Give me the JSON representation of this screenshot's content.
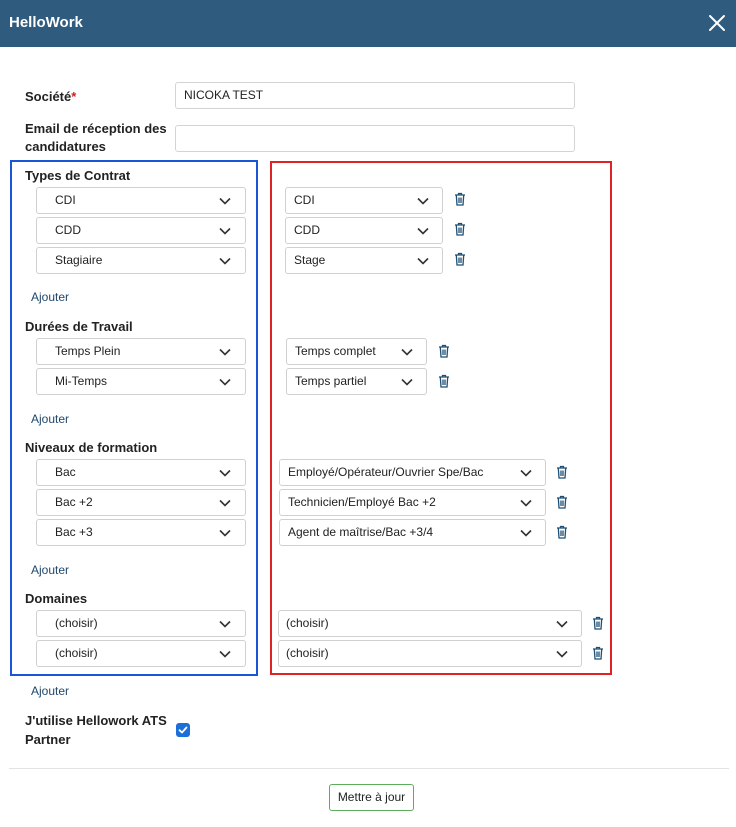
{
  "dialog": {
    "title": "HelloWork",
    "close_icon": "close-icon"
  },
  "form": {
    "societe_label": "Société",
    "required_mark": "*",
    "societe_value": "NICOKA TEST",
    "email_label_line1": "Email de réception des",
    "email_label_line2": "candidatures",
    "email_value": ""
  },
  "sections": {
    "contrat": {
      "title": "Types de Contrat",
      "left": [
        "CDI",
        "CDD",
        "Stagiaire"
      ],
      "right": [
        "CDI",
        "CDD",
        "Stage"
      ],
      "add": "Ajouter"
    },
    "duree": {
      "title": "Durées de Travail",
      "left": [
        "Temps Plein",
        "Mi-Temps"
      ],
      "right": [
        "Temps complet",
        "Temps partiel"
      ],
      "add": "Ajouter"
    },
    "niveau": {
      "title": "Niveaux de formation",
      "left": [
        "Bac",
        "Bac +2",
        "Bac +3"
      ],
      "right": [
        "Employé/Opérateur/Ouvrier Spe/Bac",
        "Technicien/Employé Bac +2",
        "Agent de maîtrise/Bac +3/4"
      ],
      "add": "Ajouter"
    },
    "domaines": {
      "title": "Domaines",
      "left": [
        "(choisir)",
        "(choisir)"
      ],
      "right": [
        "(choisir)",
        "(choisir)"
      ],
      "add": "Ajouter"
    }
  },
  "ats": {
    "label_line1": "J'utilise Hellowork ATS",
    "label_line2": "Partner",
    "checked": true
  },
  "footer": {
    "submit_label": "Mettre à jour"
  },
  "colors": {
    "header": "#2e5b7e",
    "left_frame": "#1a55d6",
    "right_frame": "#dd2323",
    "checkbox": "#1b6fd8",
    "button_border": "#5cae5c"
  }
}
